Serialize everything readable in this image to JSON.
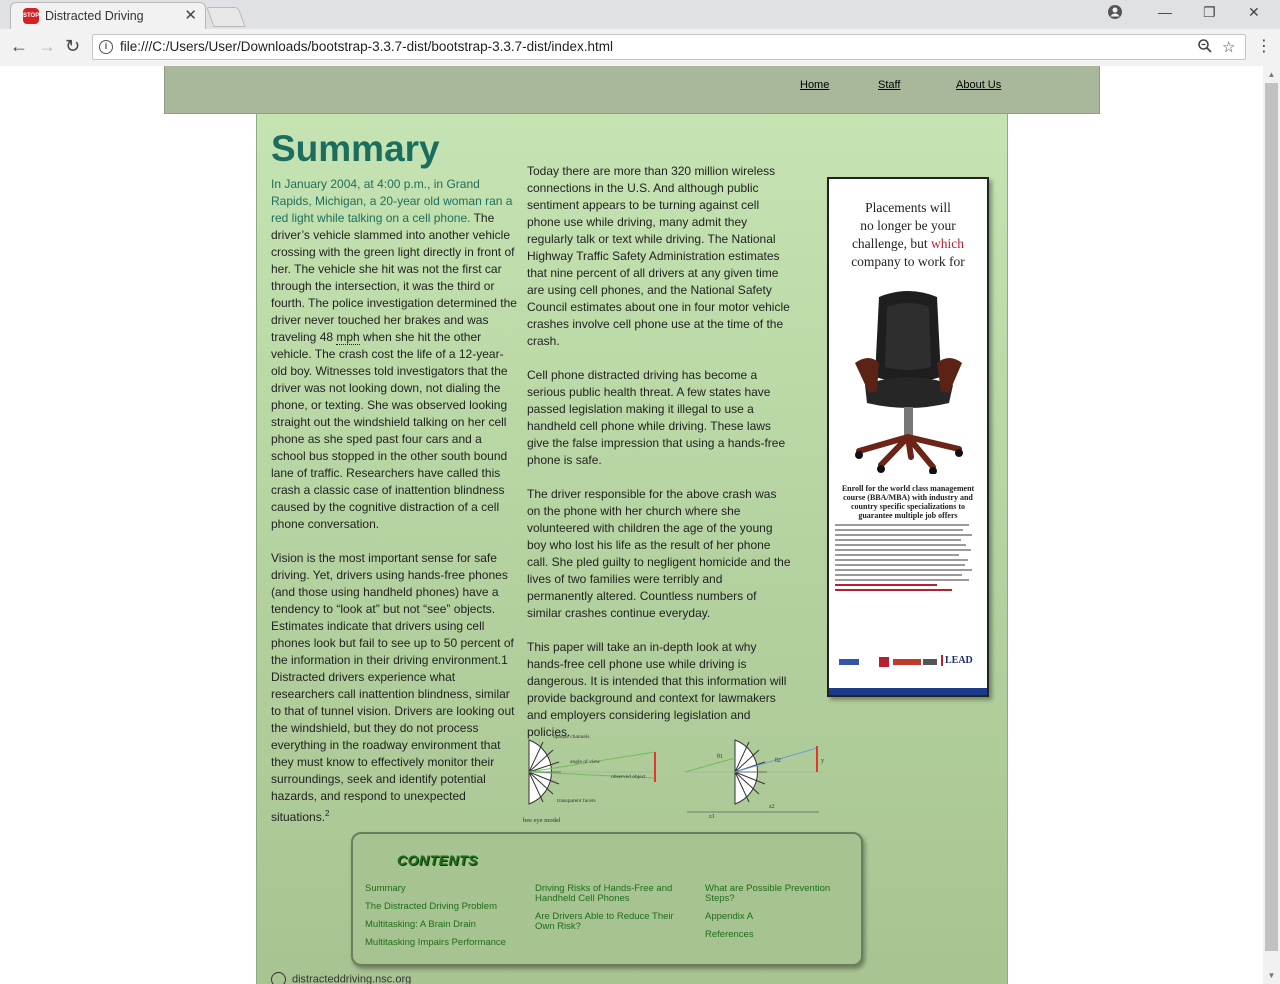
{
  "browser": {
    "tab_title": "Distracted Driving",
    "tab_icon_text": "STOP",
    "url": "file:///C:/Users/User/Downloads/bootstrap-3.3.7-dist/bootstrap-3.3.7-dist/index.html"
  },
  "nav": {
    "home": "Home",
    "staff": "Staff",
    "about": "About Us"
  },
  "page": {
    "title": "Summary",
    "col1": {
      "p1_lead": "In January 2004, at 4:00 p.m., in Grand Rapids, Michigan, a 20-year old woman ran a red light while talking on a cell phone.",
      "p1_a": " The driver’s vehicle slammed into another vehicle crossing with the green light directly in front of her. The vehicle she hit was not the first car through the intersection, it was the third or fourth. The police investigation determined the driver never touched her brakes and was traveling 48 ",
      "p1_mph": "mph",
      "p1_b": " when she hit the other vehicle. The crash cost the life of a 12-year-old boy. Witnesses told investigators that the driver was not looking down, not dialing the phone, or texting. She was observed looking straight out the windshield talking on her cell phone as she sped past four cars and a school bus stopped in the other south bound lane of traffic. Researchers have called this crash a classic case of inattention blindness caused by the cognitive distraction of a cell phone conversation.",
      "p2": "Vision is the most important sense for safe driving. Yet, drivers using hands-free phones (and those using handheld phones) have a tendency to “look at” but not “see” objects. Estimates indicate that drivers using cell phones look but fail to see up to 50 percent of the information in their driving environment.1 Distracted drivers experience what researchers call inattention blindness, similar to that of tunnel vision. Drivers are looking out the windshield, but they do not process everything in the roadway environment that they must know to effectively monitor their surroundings, seek and identify potential hazards, and respond to unexpected situations.",
      "p2_sup": "2"
    },
    "col2": {
      "p1": "Today there are more than 320 million wireless connections in the U.S. And although public sentiment appears to be turning against cell phone use while driving, many admit they regularly talk or text while driving. The National Highway Traffic Safety Administration estimates that nine percent of all drivers at any given time are using cell phones, and the National Safety Council estimates about one in four motor vehicle crashes involve cell phone use at the time of the crash.",
      "p2": "Cell phone distracted driving has become a serious public health threat. A few states have passed legislation making it illegal to use a handheld cell phone while driving. These laws give the false impression that using a hands-free phone is safe.",
      "p3": "The driver responsible for the above crash was on the phone with her church where she volunteered with children the age of the young boy who lost his life as the result of her phone call. She pled guilty to negligent homicide and the lives of two families were terribly and permanently altered. Countless numbers of similar crashes continue everyday.",
      "p4": "This paper will take an in-depth look at why hands-free cell phone use while driving is dangerous. It is intended that this information will provide background and context for lawmakers and employers considering legislation and policies."
    },
    "ad": {
      "line1": "Placements will",
      "line2": "no longer be your",
      "line3a": "challenge, but ",
      "line3b": "which",
      "line4": "company to work  for",
      "enroll": "Enroll for the world class management course (BBA/MBA) with industry and country specific specializations to guarantee multiple job offers",
      "brand": "LEAD"
    },
    "diagram": {
      "opaque": "opaque channels",
      "angle": "angle of view",
      "observed": "observed object",
      "transparent": "transparent facets",
      "model": "bee eye model",
      "theta1": "θ1",
      "theta2": "θ2",
      "y": "y",
      "z1": "z1",
      "z2": "z2"
    },
    "contents": {
      "title": "CONTENTS",
      "col1": [
        "Summary",
        "The Distracted Driving Problem",
        "Multitasking: A Brain Drain",
        "Multitasking Impairs Performance"
      ],
      "col2": [
        "Driving Risks of Hands-Free and Handheld Cell Phones",
        "Are Drivers Able to Reduce Their Own Risk?"
      ],
      "col3": [
        "What are Possible Prevention Steps?",
        "Appendix A",
        "References"
      ]
    },
    "footer_url": "distracteddriving.nsc.org"
  }
}
